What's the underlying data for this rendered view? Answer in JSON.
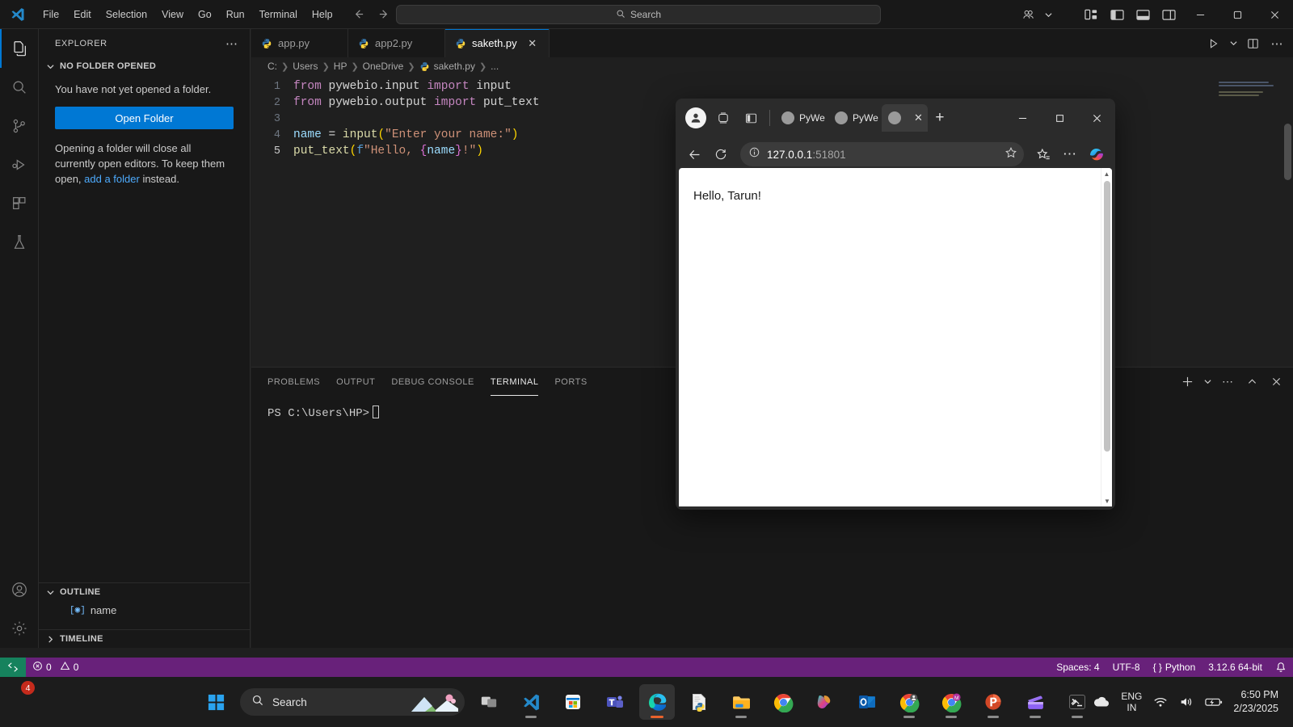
{
  "vscode": {
    "menu": [
      "File",
      "Edit",
      "Selection",
      "View",
      "Go",
      "Run",
      "Terminal",
      "Help"
    ],
    "command_center_placeholder": "Search",
    "titlebar_icons": [
      "back-arrow-icon",
      "forward-arrow-icon",
      "search-icon",
      "accounts-icon",
      "chevron-down-icon"
    ],
    "window_controls": [
      "minimize",
      "maximize",
      "close"
    ],
    "activity_bar": [
      {
        "name": "explorer",
        "icon": "files-icon",
        "active": true
      },
      {
        "name": "search",
        "icon": "search-icon",
        "active": false
      },
      {
        "name": "source-control",
        "icon": "source-control-icon",
        "active": false
      },
      {
        "name": "run-and-debug",
        "icon": "run-debug-icon",
        "active": false
      },
      {
        "name": "extensions",
        "icon": "extensions-icon",
        "active": false
      },
      {
        "name": "testing",
        "icon": "beaker-icon",
        "active": false
      },
      {
        "name": "accounts",
        "icon": "account-icon",
        "active": false
      },
      {
        "name": "settings",
        "icon": "gear-icon",
        "active": false
      }
    ],
    "sidebar": {
      "title": "EXPLORER",
      "no_folder_section": "NO FOLDER OPENED",
      "no_folder_text": "You have not yet opened a folder.",
      "open_folder_label": "Open Folder",
      "note_before_link": "Opening a folder will close all currently open editors. To keep them open, ",
      "note_link": "add a folder",
      "note_after_link": " instead.",
      "outline_title": "OUTLINE",
      "outline_items": [
        {
          "label": "name",
          "icon": "variable-icon"
        }
      ],
      "timeline_title": "TIMELINE"
    },
    "tabs": [
      {
        "label": "app.py",
        "icon": "python-icon",
        "active": false,
        "closable": false
      },
      {
        "label": "app2.py",
        "icon": "python-icon",
        "active": false,
        "closable": false
      },
      {
        "label": "saketh.py",
        "icon": "python-icon",
        "active": true,
        "closable": true
      }
    ],
    "editor_actions": [
      "run-python-file-button",
      "run-chevron-down-icon",
      "split-editor-button",
      "more-actions-icon"
    ],
    "breadcrumb": [
      "C:",
      "Users",
      "HP",
      "OneDrive",
      "saketh.py",
      "..."
    ],
    "code_lines": [
      {
        "num": "1",
        "text": "from pywebio.input import input"
      },
      {
        "num": "2",
        "text": "from pywebio.output import put_text"
      },
      {
        "num": "3",
        "text": ""
      },
      {
        "num": "4",
        "text": "name = input(\"Enter your name:\")"
      },
      {
        "num": "5",
        "text": "put_text(f\"Hello, {name}!\")"
      }
    ],
    "panel": {
      "tabs": [
        "PROBLEMS",
        "OUTPUT",
        "DEBUG CONSOLE",
        "TERMINAL",
        "PORTS"
      ],
      "active_tab": "TERMINAL",
      "actions": [
        "new-terminal-button",
        "terminal-chevron-down-icon",
        "views-and-more-actions-icon",
        "maximize-panel-icon",
        "close-panel-icon"
      ],
      "terminal_prompt": "PS C:\\Users\\HP>"
    },
    "statusbar": {
      "remote_icon": "remote-window-icon",
      "errors": "0",
      "warnings": "0",
      "spaces": "Spaces: 4",
      "encoding": "UTF-8",
      "language": "Python",
      "interpreter": "3.12.6 64-bit",
      "bell_icon": "notifications-bell-icon"
    }
  },
  "browser": {
    "toolbar_icons": [
      "profile-avatar-icon",
      "workspaces-icon",
      "tab-actions-icon"
    ],
    "tabs": [
      {
        "label": "PyWe",
        "active": false
      },
      {
        "label": "PyWe",
        "active": false
      },
      {
        "label": "",
        "active": true
      }
    ],
    "new_tab_label": "+",
    "window_controls": [
      "minimize",
      "maximize",
      "close"
    ],
    "nav": {
      "back_icon": "back-arrow-icon",
      "refresh_icon": "refresh-icon",
      "info_icon": "site-information-icon",
      "url_host": "127.0.0.1",
      "url_port": ":51801",
      "favorite_icon": "star-icon",
      "collections_icon": "collections-icon",
      "settings_icon": "more-options-icon",
      "copilot_icon": "copilot-icon"
    },
    "page": {
      "text": "Hello, Tarun!"
    }
  },
  "taskbar": {
    "start_icon": "windows-start-icon",
    "search_placeholder": "Search",
    "apps": [
      {
        "name": "task-view",
        "active": false
      },
      {
        "name": "visual-studio-code",
        "active": false,
        "running": true
      },
      {
        "name": "microsoft-store",
        "active": false
      },
      {
        "name": "microsoft-teams",
        "active": false
      },
      {
        "name": "microsoft-edge",
        "active": true,
        "running": true
      },
      {
        "name": "python-idle",
        "active": false,
        "running": true
      },
      {
        "name": "file-explorer",
        "active": false,
        "running": true
      },
      {
        "name": "google-chrome",
        "active": false,
        "running": false
      },
      {
        "name": "microsoft-copilot",
        "active": false,
        "running": false
      },
      {
        "name": "microsoft-outlook",
        "active": false,
        "running": false
      },
      {
        "name": "chrome-profile",
        "active": false,
        "running": true
      },
      {
        "name": "chrome-meet",
        "active": false,
        "running": true
      },
      {
        "name": "microsoft-powerpoint",
        "active": false,
        "running": true
      },
      {
        "name": "clipchamp",
        "active": false,
        "running": true
      },
      {
        "name": "windows-terminal",
        "active": false,
        "running": true
      }
    ],
    "tray": {
      "chevron_icon": "show-hidden-icons-icon",
      "onedrive_icon": "onedrive-icon",
      "language_top": "ENG",
      "language_bottom": "IN",
      "wifi_icon": "wifi-icon",
      "volume_icon": "volume-icon",
      "battery_icon": "battery-charging-icon",
      "time": "6:50 PM",
      "date": "2/23/2025",
      "notification_count": "4"
    }
  },
  "colors": {
    "vscode_accent": "#0078d4",
    "statusbar": "#68217a",
    "remote": "#16825d",
    "link": "#4daafc"
  }
}
